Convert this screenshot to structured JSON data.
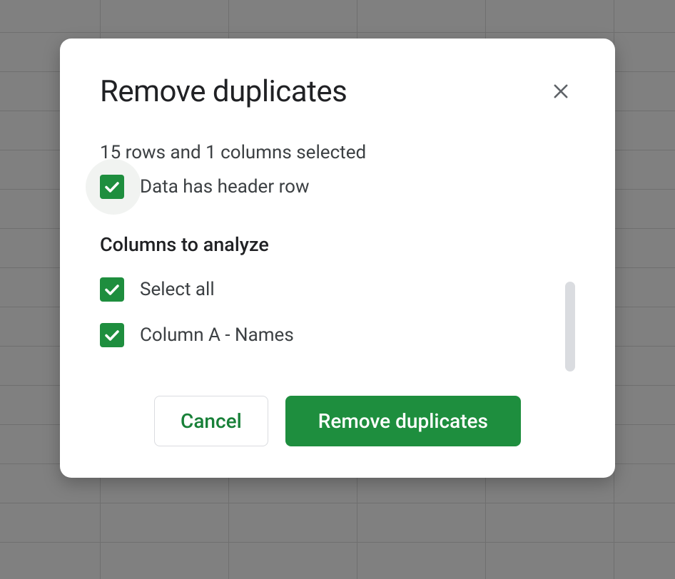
{
  "dialog": {
    "title": "Remove duplicates",
    "selection_info": "15 rows and 1 columns selected",
    "header_row_label": "Data has header row",
    "section_heading": "Columns to analyze",
    "select_all_label": "Select all",
    "columns": [
      {
        "label": "Column A - Names",
        "checked": true
      }
    ],
    "cancel_label": "Cancel",
    "confirm_label": "Remove duplicates"
  },
  "colors": {
    "accent_green": "#1e8e3e"
  }
}
